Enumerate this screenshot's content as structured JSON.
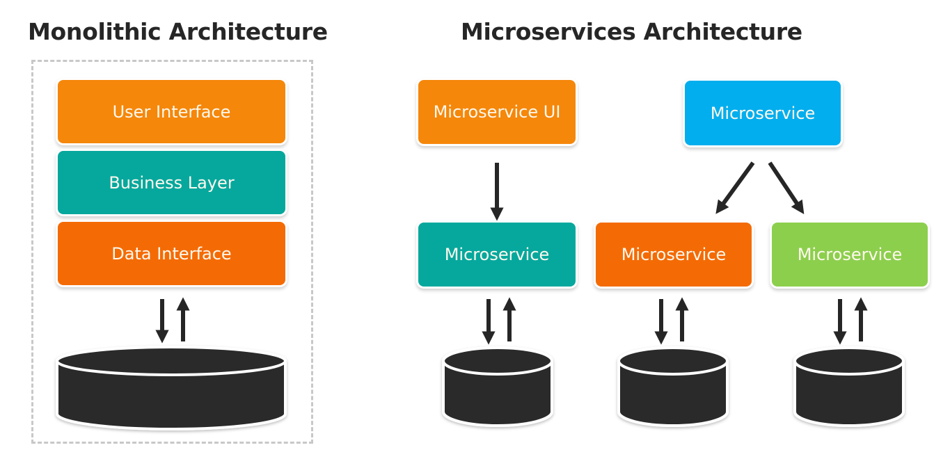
{
  "monolithic": {
    "title": "Monolithic Architecture",
    "layers": [
      {
        "label": "User Interface",
        "color": "#f5870a"
      },
      {
        "label": "Business Layer",
        "color": "#06a89d"
      },
      {
        "label": "Data Interface",
        "color": "#f46b05"
      }
    ],
    "database": {
      "icon": "database-icon",
      "connection": "bidirectional"
    }
  },
  "microservices": {
    "title": "Microservices Architecture",
    "nodes": [
      {
        "id": "ui",
        "label": "Microservice UI",
        "color": "#f5870a"
      },
      {
        "id": "top",
        "label": "Microservice",
        "color": "#03aeee"
      },
      {
        "id": "teal",
        "label": "Microservice",
        "color": "#06a89d"
      },
      {
        "id": "orange",
        "label": "Microservice",
        "color": "#f46b05"
      },
      {
        "id": "green",
        "label": "Microservice",
        "color": "#8ccf4d"
      }
    ],
    "edges": [
      {
        "from": "ui",
        "to": "teal"
      },
      {
        "from": "top",
        "to": "orange"
      },
      {
        "from": "top",
        "to": "green"
      }
    ],
    "databases": [
      {
        "attached_to": "teal",
        "icon": "database-icon",
        "connection": "bidirectional"
      },
      {
        "attached_to": "orange",
        "icon": "database-icon",
        "connection": "bidirectional"
      },
      {
        "attached_to": "green",
        "icon": "database-icon",
        "connection": "bidirectional"
      }
    ]
  }
}
